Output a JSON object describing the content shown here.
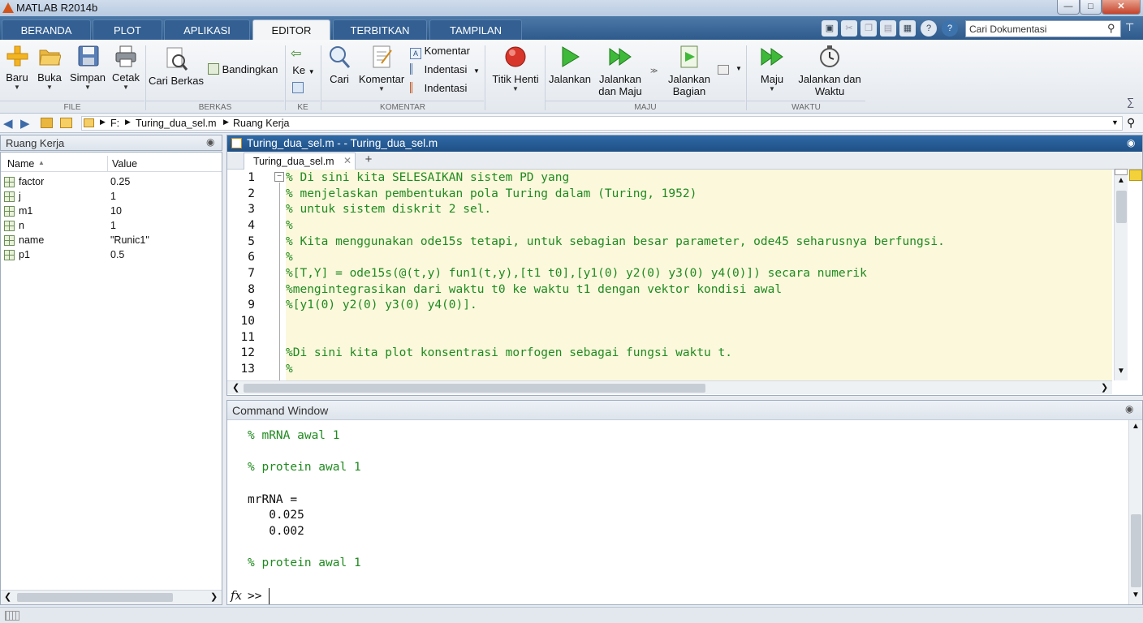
{
  "window": {
    "title": "MATLAB R2014b"
  },
  "tabs": [
    {
      "label": "BERANDA"
    },
    {
      "label": "PLOT"
    },
    {
      "label": "APLIKASI"
    },
    {
      "label": "EDITOR"
    },
    {
      "label": "TERBITKAN"
    },
    {
      "label": "TAMPILAN"
    }
  ],
  "search": {
    "placeholder": "Cari Dokumentasi"
  },
  "ribbon": {
    "baru": "Baru",
    "buka": "Buka",
    "simpan": "Simpan",
    "cetak": "Cetak",
    "cari_berkas": "Cari Berkas",
    "bandingkan": "Bandingkan",
    "ke": "Ke",
    "cari": "Cari",
    "komentar_big": "Komentar",
    "komentar": "Komentar",
    "indentasi1": "Indentasi",
    "indentasi2": "Indentasi",
    "titik_henti": "Titik Henti",
    "jalankan": "Jalankan",
    "jalankan_dan_maju": [
      "Jalankan",
      "dan Maju"
    ],
    "jalankan_bagian": [
      "Jalankan",
      "Bagian"
    ],
    "maju": "Maju",
    "jalankan_dan_waktu": [
      "Jalankan dan",
      "Waktu"
    ],
    "groups": [
      "FILE",
      "BERKAS",
      "KE",
      "KOMENTAR",
      "MAJU",
      "WAKTU"
    ]
  },
  "path": {
    "drive": "F:",
    "file": "Turing_dua_sel.m",
    "folder": "Ruang Kerja"
  },
  "workspace": {
    "title": "Ruang Kerja",
    "col_name": "Name",
    "col_value": "Value",
    "vars": [
      {
        "name": "factor",
        "value": "0.25"
      },
      {
        "name": "j",
        "value": "1"
      },
      {
        "name": "m1",
        "value": "10"
      },
      {
        "name": "n",
        "value": "1"
      },
      {
        "name": "name",
        "value": "\"Runic1\""
      },
      {
        "name": "p1",
        "value": "0.5"
      }
    ]
  },
  "editor": {
    "title": "Turing_dua_sel.m - - Turing_dua_sel.m",
    "tab": "Turing_dua_sel.m",
    "add_tab": "+",
    "lines": [
      {
        "n": "1",
        "text": "% Di sini kita SELESAIKAN sistem PD yang"
      },
      {
        "n": "2",
        "text": "% menjelaskan pembentukan pola Turing dalam (Turing, 1952)"
      },
      {
        "n": "3",
        "text": "% untuk sistem diskrit 2 sel."
      },
      {
        "n": "4",
        "text": "%"
      },
      {
        "n": "5",
        "text": "% Kita menggunakan ode15s tetapi, untuk sebagian besar parameter, ode45 seharusnya berfungsi."
      },
      {
        "n": "6",
        "text": "%"
      },
      {
        "n": "7",
        "text": "%[T,Y] = ode15s(@(t,y) fun1(t,y),[t1 t0],[y1(0) y2(0) y3(0) y4(0)]) secara numerik"
      },
      {
        "n": "8",
        "text": "%mengintegrasikan dari waktu t0 ke waktu t1 dengan vektor kondisi awal"
      },
      {
        "n": "9",
        "text": "%[y1(0) y2(0) y3(0) y4(0)]."
      },
      {
        "n": "10",
        "text": ""
      },
      {
        "n": "11",
        "text": ""
      },
      {
        "n": "12",
        "text": "%Di sini kita plot konsentrasi morfogen sebagai fungsi waktu t."
      },
      {
        "n": "13",
        "text": "%"
      }
    ]
  },
  "command": {
    "title": "Command Window",
    "lines": [
      {
        "text": "% mRNA awal 1",
        "green": true
      },
      {
        "text": "% protein awal 1",
        "green": true
      },
      {
        "text": "mrRNA =",
        "green": false
      },
      {
        "text": "   0.025",
        "green": false
      },
      {
        "text": "   0.002",
        "green": false
      },
      {
        "text": "% protein awal 1",
        "green": true
      }
    ],
    "prompt": ">>",
    "fx": "fx"
  }
}
